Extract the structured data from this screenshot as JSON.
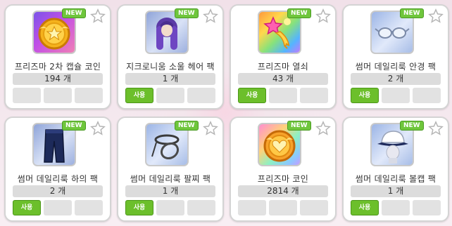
{
  "badge_new": "NEW",
  "use_label": "사용",
  "items": [
    {
      "name": "프리즈마 2차 캡슐 코인",
      "qty": "194 개",
      "icon": "gold-coin-icon",
      "has_use": false
    },
    {
      "name": "지크로니움 소울 헤어 팩",
      "qty": "1 개",
      "icon": "purple-hair-icon",
      "has_use": true
    },
    {
      "name": "프리즈마 열쇠",
      "qty": "43 개",
      "icon": "star-key-icon",
      "has_use": true
    },
    {
      "name": "썸머 데일리룩 안경 팩",
      "qty": "2 개",
      "icon": "glasses-icon",
      "has_use": true
    },
    {
      "name": "썸머 데일리룩 하의 팩",
      "qty": "2 개",
      "icon": "pants-icon",
      "has_use": true
    },
    {
      "name": "썸머 데일리룩 팔찌 팩",
      "qty": "1 개",
      "icon": "bracelet-icon",
      "has_use": true
    },
    {
      "name": "프리즈마 코인",
      "qty": "2814 개",
      "icon": "heart-coin-icon",
      "has_use": false
    },
    {
      "name": "썸머 데일리룩 볼캡 팩",
      "qty": "1 개",
      "icon": "cap-icon",
      "has_use": true
    }
  ]
}
